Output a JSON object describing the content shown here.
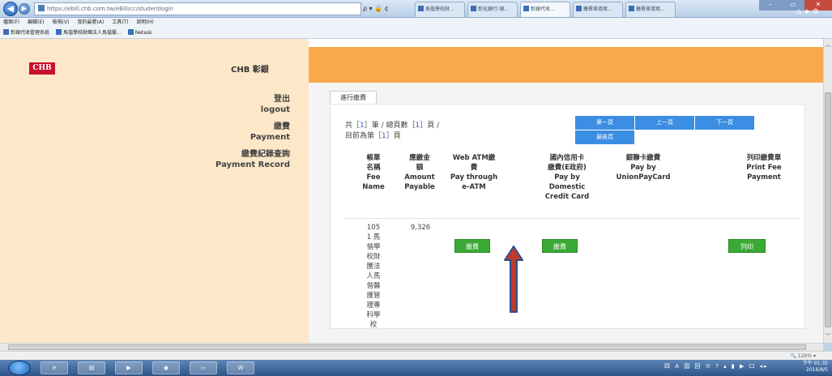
{
  "browser": {
    "url": "https://ebill.chb.com.tw/eBill/cc/studentlogin",
    "addr_tools": "ρ ▾ 🔒 ¢",
    "tabs": [
      {
        "label": "馬偕學校財..."
      },
      {
        "label": "彰化銀行-領..."
      },
      {
        "label": "彰銀代收..."
      },
      {
        "label": "繳費單填寫..."
      },
      {
        "label": "繳費單填寫..."
      }
    ],
    "menu": [
      "檔案(F)",
      "編輯(E)",
      "檢視(V)",
      "我的最愛(A)",
      "工具(T)",
      "說明(H)"
    ],
    "favorites": [
      "彰銀代收管理系統",
      "馬偕學校財團法人馬偕醫...",
      "Netask"
    ],
    "right_icons": "⌂ ★ ⚙",
    "zoom": "🔍 120%  ▾"
  },
  "sidebar": {
    "logo_text": "CHB",
    "bank_name": "CHB 彰銀",
    "items": [
      {
        "zh": "登出",
        "en": "logout"
      },
      {
        "zh": "繳費",
        "en": "Payment"
      },
      {
        "zh": "繳費紀錄查詢",
        "en": "Payment Record"
      }
    ]
  },
  "main": {
    "tab_label": "進行繳費",
    "summary": {
      "line1_prefix": "共［",
      "total_records": "1",
      "line1_mid": "］筆 / 總頁數［",
      "total_pages": "1",
      "line1_suffix": "］頁 /",
      "line2_prefix": "目前為第［",
      "current_page": "1",
      "line2_suffix": "］頁"
    },
    "pager": {
      "first": "第一頁",
      "prev": "上一頁",
      "next": "下一頁",
      "last": "最後頁"
    },
    "columns": {
      "bill_name": "帳單\n名稱\nFee\nName",
      "amount": "應繳金\n額\nAmount\nPayable",
      "webatm": "Web ATM繳\n費\nPay through\ne-ATM",
      "credit": "國內信用卡\n繳費(E政府)\nPay by\nDomestic\nCredit Card",
      "unionpay": "銀聯卡繳費\nPay by\nUnionPayCard",
      "print": "列印繳費單\nPrint Fee\nPayment"
    },
    "row": {
      "bill_name": "105\n1 馬\n偕學\n校財\n團法\n人馬\n偕醫\n護管\n理專\n科學\n校",
      "amount": "9,326",
      "webatm_button": "繳費",
      "credit_button": "繳費",
      "print_button": "列印"
    }
  },
  "taskbar": {
    "tray": "四 A 国 回 ⑦ ? ▴ ▮ ▶ 口 ◂▸",
    "clock_time": "下午 01:35",
    "clock_date": "2016/8/5"
  },
  "colors": {
    "orange": "#f8a94c",
    "left_panel": "#fce8c8",
    "blue_button": "#3b8ee3",
    "green_button": "#3aa935",
    "logo_red": "#c8102e"
  }
}
